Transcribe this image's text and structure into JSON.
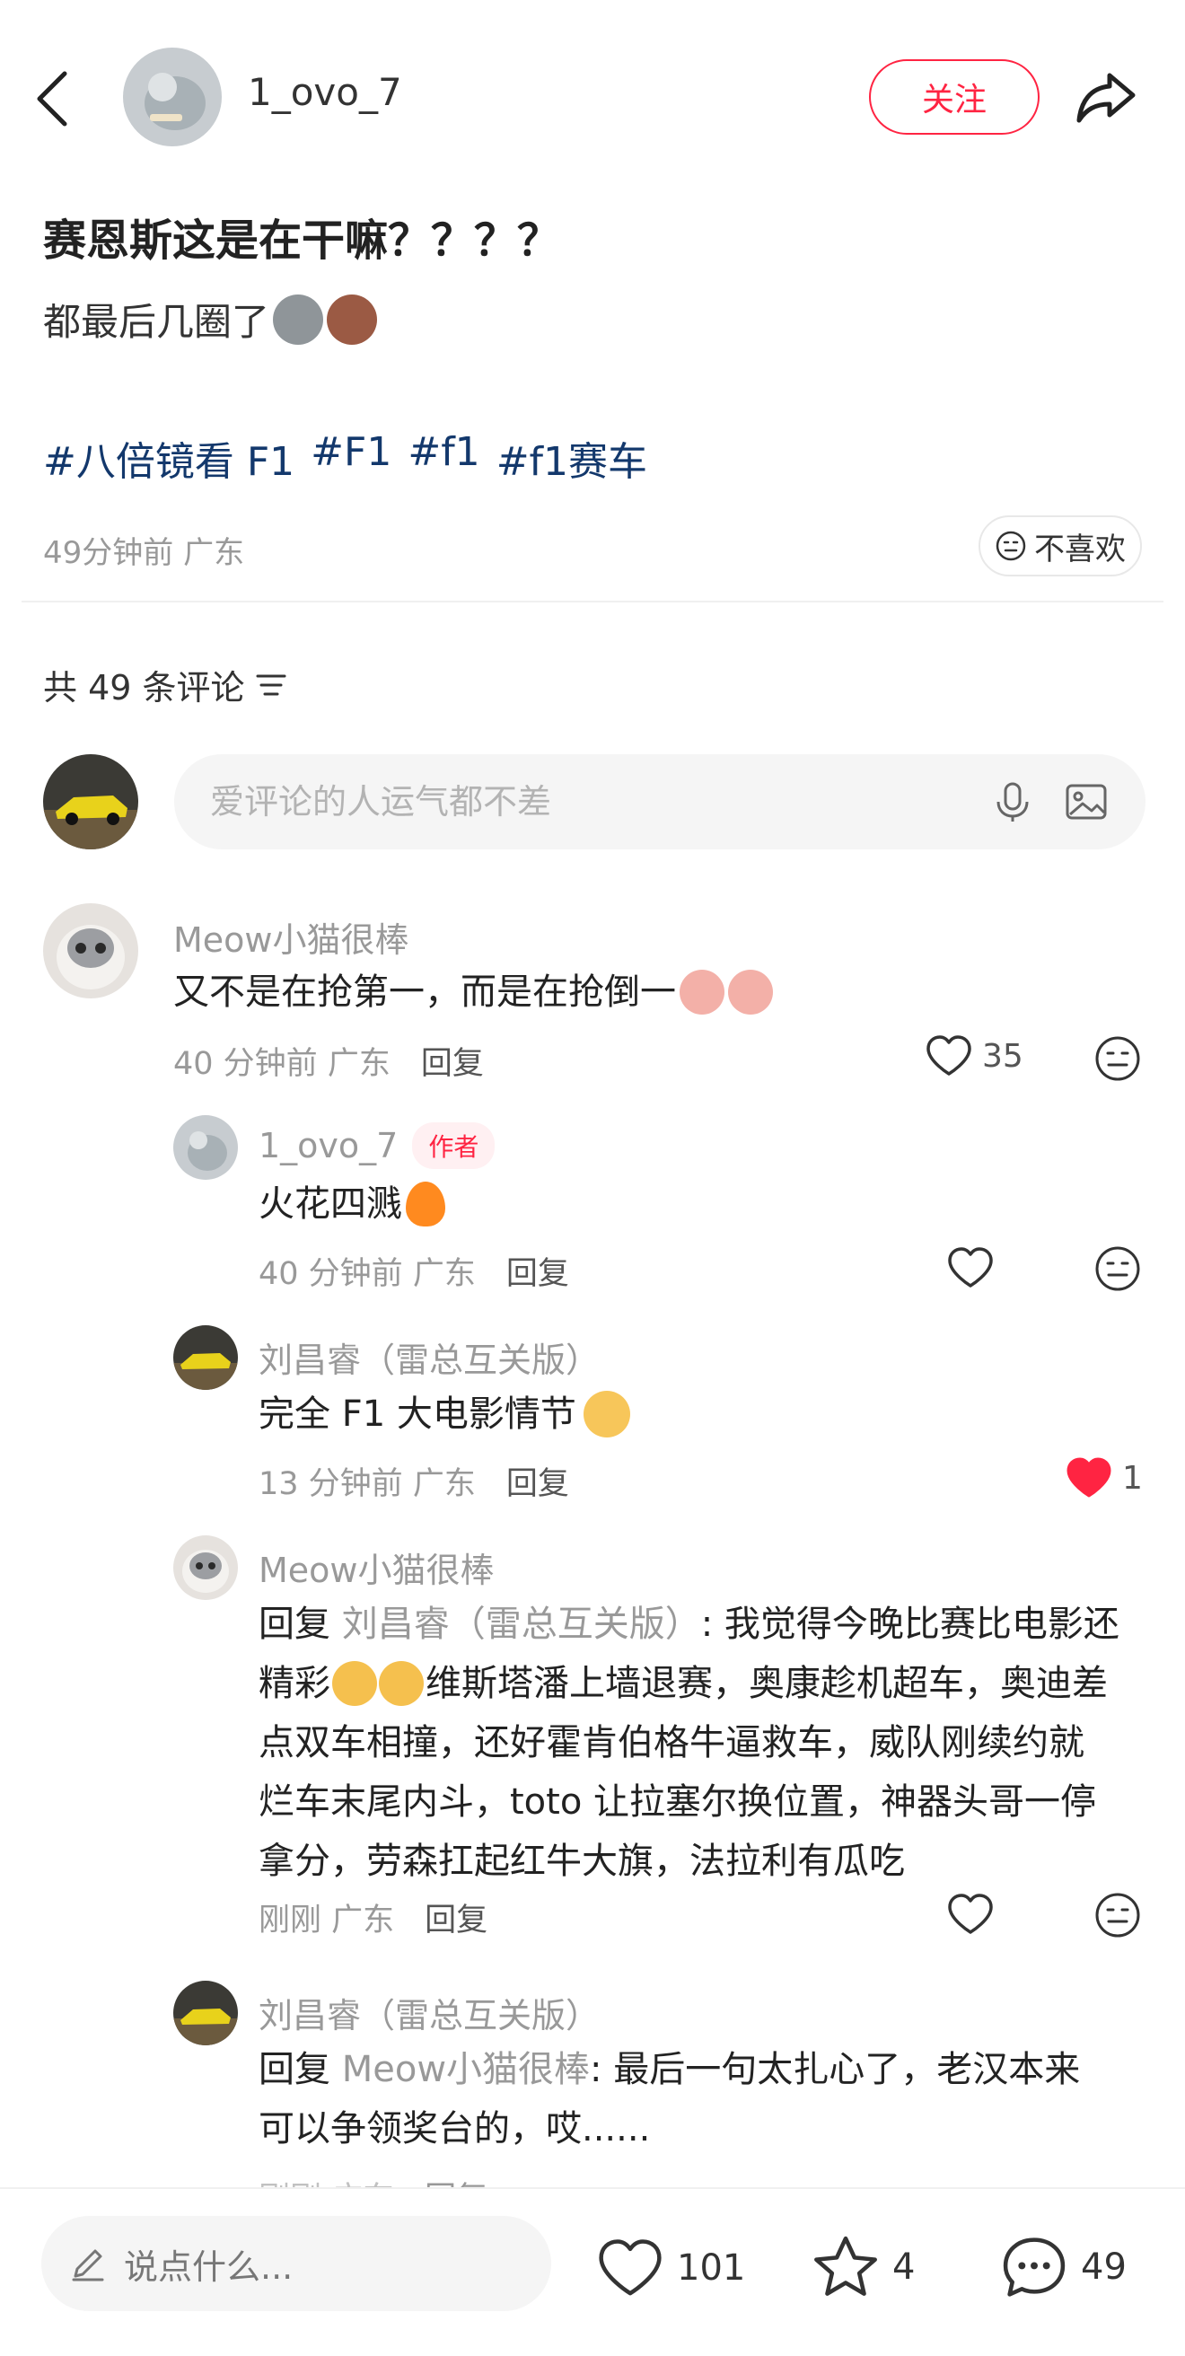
{
  "header": {
    "username": "1_ovo_7",
    "follow_label": "关注"
  },
  "post": {
    "title": "赛恩斯这是在干嘛？？？？",
    "body": "都最后几圈了",
    "tags": [
      "#八倍镜看 F1",
      "#F1",
      "#f1",
      "#f1赛车"
    ],
    "meta": "49分钟前 广东",
    "dislike_label": "不喜欢"
  },
  "comments_header": {
    "count_label": "共 49 条评论"
  },
  "comment_input": {
    "placeholder": "爱评论的人运气都不差"
  },
  "comments": [
    {
      "name": "Meow小猫很棒",
      "text": "又不是在抢第一，而是在抢倒一",
      "time": "40 分钟前",
      "location": "广东",
      "reply_label": "回复",
      "likes": "35"
    },
    {
      "name": "1_ovo_7",
      "badge": "作者",
      "text": "火花四溅",
      "time": "40 分钟前",
      "location": "广东",
      "reply_label": "回复"
    },
    {
      "name": "刘昌睿（雷总互关版）",
      "text": "完全 F1 大电影情节",
      "time": "13 分钟前",
      "location": "广东",
      "reply_label": "回复",
      "likes": "1",
      "liked": true
    },
    {
      "name": "Meow小猫很棒",
      "reply_prefix": "回复",
      "reply_to": "刘昌睿（雷总互关版）",
      "lines": [
        ": 我觉得今晚比赛比电影还",
        "精彩",
        "维斯塔潘上墙退赛，奥康趁机超车，奥迪差",
        "点双车相撞，还好霍肯伯格牛逼救车，威队刚续约就",
        "烂车末尾内斗，toto 让拉塞尔换位置，神器头哥一停",
        "拿分，劳森扛起红牛大旗，法拉利有瓜吃"
      ],
      "time": "刚刚",
      "location": "广东",
      "reply_label": "回复"
    },
    {
      "name": "刘昌睿（雷总互关版）",
      "reply_prefix": "回复",
      "reply_to": "Meow小猫很棒",
      "lines": [
        ": 最后一句太扎心了，老汉本来",
        "可以争领奖台的，哎......"
      ],
      "time": "刚刚",
      "location": "广东",
      "reply_label": "回复"
    }
  ],
  "bottom_bar": {
    "input_placeholder": "说点什么...",
    "likes": "101",
    "favorites": "4",
    "comments": "49"
  },
  "colors": {
    "accent": "#ff2442",
    "hashtag": "#13386c",
    "muted": "#999999"
  }
}
